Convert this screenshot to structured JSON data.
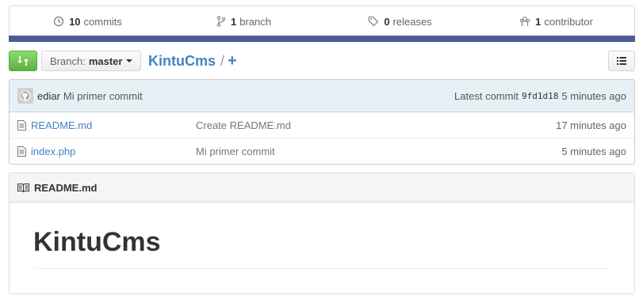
{
  "stats": {
    "commits": {
      "count": "10",
      "label": "commits"
    },
    "branches": {
      "count": "1",
      "label": "branch"
    },
    "releases": {
      "count": "0",
      "label": "releases"
    },
    "contributors": {
      "count": "1",
      "label": "contributor"
    }
  },
  "language_bar_color": "#4f5b93",
  "toolbar": {
    "branch_label": "Branch:",
    "branch_name": "master",
    "repo_name": "KintuCms",
    "separator": "/",
    "add_file": "+"
  },
  "latest_commit": {
    "author": "ediar",
    "message": "Mi primer commit",
    "label": "Latest commit",
    "sha": "9fd1d18",
    "age": "5 minutes ago"
  },
  "files": [
    {
      "name": "README.md",
      "message": "Create README.md",
      "age": "17 minutes ago"
    },
    {
      "name": "index.php",
      "message": "Mi primer commit",
      "age": "5 minutes ago"
    }
  ],
  "readme": {
    "header": "README.md",
    "title": "KintuCms"
  },
  "colors": {
    "accent_link": "#4183c4",
    "compare_green": "#60b044",
    "commit_tease_bg": "#e6f1f6"
  }
}
